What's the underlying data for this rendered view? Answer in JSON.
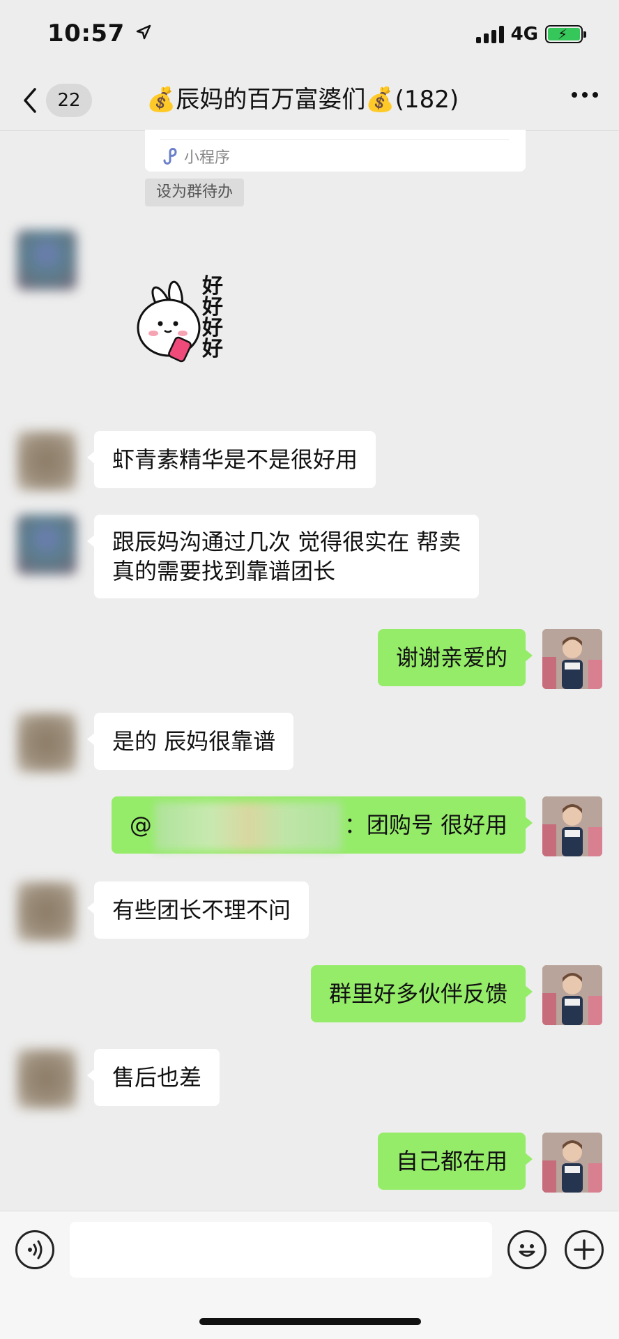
{
  "status_bar": {
    "time": "10:57",
    "network": "4G"
  },
  "nav": {
    "unread_count": "22",
    "title": "💰辰妈的百万富婆们💰(182)"
  },
  "card": {
    "mini_program_label": "小程序",
    "set_todo_label": "设为群待办"
  },
  "sticker": {
    "text": "好好好好"
  },
  "messages": [
    {
      "side": "in",
      "text": "虾青素精华是不是很好用"
    },
    {
      "side": "in",
      "line1": "跟辰妈沟通过几次 觉得很实在 帮卖",
      "line2": "真的需要找到靠谱团长"
    },
    {
      "side": "out",
      "text": "谢谢亲爱的"
    },
    {
      "side": "in",
      "text": "是的 辰妈很靠谱"
    },
    {
      "side": "out",
      "mention_prefix": "@",
      "text": "：团购号 很好用"
    },
    {
      "side": "in",
      "text": "有些团长不理不问"
    },
    {
      "side": "out",
      "text": "群里好多伙伴反馈"
    },
    {
      "side": "in",
      "text": "售后也差"
    },
    {
      "side": "out",
      "text": "自己都在用"
    }
  ],
  "colors": {
    "background": "#ededed",
    "outgoing_bubble": "#95ec69",
    "incoming_bubble": "#ffffff"
  },
  "icons": [
    "location-arrow-icon",
    "signal-icon",
    "battery-icon",
    "back-chevron-icon",
    "more-icon",
    "mini-program-icon",
    "voice-icon",
    "emoji-icon",
    "plus-icon"
  ]
}
